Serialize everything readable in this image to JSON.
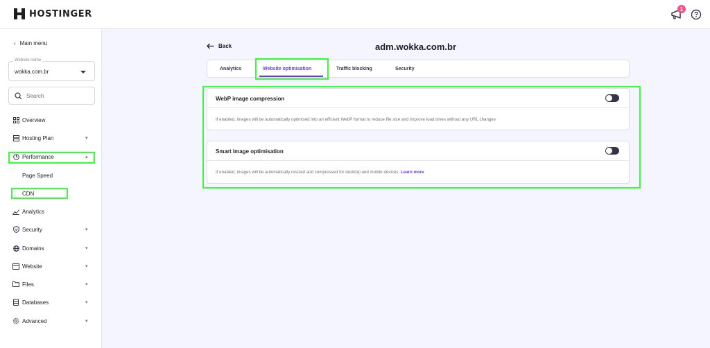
{
  "brand": {
    "name": "HOSTINGER"
  },
  "topbar": {
    "notification_count": "1",
    "icons": [
      "megaphone-icon",
      "help-icon"
    ]
  },
  "sidebar": {
    "main_menu_label": "Main menu",
    "website_select": {
      "label": "Website name",
      "value": "wokka.com.br"
    },
    "search_placeholder": "Search",
    "items": [
      {
        "label": "Overview",
        "icon": "overview-icon"
      },
      {
        "label": "Hosting Plan",
        "icon": "hosting-plan-icon",
        "expandable": true
      },
      {
        "label": "Performance",
        "icon": "performance-icon",
        "expandable": true,
        "expanded": true
      },
      {
        "label": "Page Speed",
        "sub": true
      },
      {
        "label": "CDN",
        "sub": true,
        "active": true
      },
      {
        "label": "Analytics",
        "icon": "analytics-icon"
      },
      {
        "label": "Security",
        "icon": "shield-icon",
        "expandable": true
      },
      {
        "label": "Domains",
        "icon": "globe-icon",
        "expandable": true
      },
      {
        "label": "Website",
        "icon": "browser-icon",
        "expandable": true
      },
      {
        "label": "Files",
        "icon": "folder-icon",
        "expandable": true
      },
      {
        "label": "Databases",
        "icon": "database-icon",
        "expandable": true
      },
      {
        "label": "Advanced",
        "icon": "gear-icon",
        "expandable": true
      }
    ]
  },
  "header": {
    "back_label": "Back",
    "domain": "adm.wokka.com.br"
  },
  "tabs": [
    {
      "label": "Analytics",
      "active": false
    },
    {
      "label": "Website optimisation",
      "active": true
    },
    {
      "label": "Traffic blocking",
      "active": false
    },
    {
      "label": "Security",
      "active": false
    }
  ],
  "settings": [
    {
      "title": "WebP image compression",
      "description": "If enabled, images will be automatically optimised into an efficient WebP format to reduce file size and improve load times without any URL changes",
      "enabled": false
    },
    {
      "title": "Smart image optimisation",
      "description": "If enabled, images will be automatically resized and compressed for desktop and mobile devices.",
      "link_label": "Learn more",
      "enabled": false
    }
  ],
  "colors": {
    "accent": "#673de6",
    "highlight": "#33ff33",
    "badge": "#fc5185",
    "toggle_off": "#36344d"
  }
}
